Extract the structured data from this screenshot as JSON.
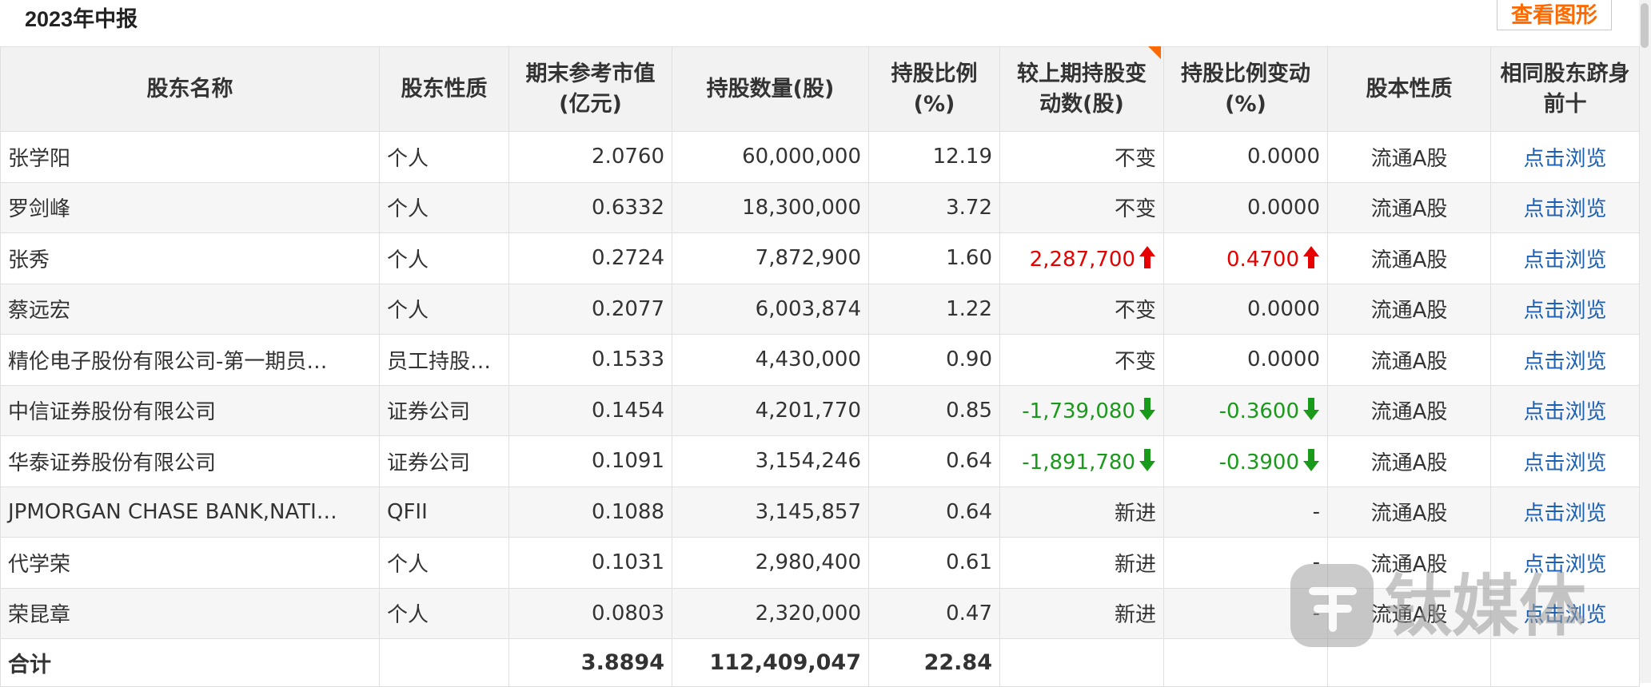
{
  "report": {
    "title": "2023年中报",
    "view_chart": "查看图形"
  },
  "columns": [
    "股东名称",
    "股东性质",
    "期末参考市值(亿元)",
    "持股数量(股)",
    "持股比例(%)",
    "较上期持股变动数(股)",
    "持股比例变动(%)",
    "股本性质",
    "相同股东跻身前十"
  ],
  "rows": [
    {
      "name": "张学阳",
      "type": "个人",
      "value": "2.0760",
      "shares": "60,000,000",
      "ratio": "12.19",
      "change": "不变",
      "change_dir": "",
      "ratio_change": "0.0000",
      "ratio_dir": "",
      "nature": "流通A股",
      "link": "点击浏览"
    },
    {
      "name": "罗剑峰",
      "type": "个人",
      "value": "0.6332",
      "shares": "18,300,000",
      "ratio": "3.72",
      "change": "不变",
      "change_dir": "",
      "ratio_change": "0.0000",
      "ratio_dir": "",
      "nature": "流通A股",
      "link": "点击浏览"
    },
    {
      "name": "张秀",
      "type": "个人",
      "value": "0.2724",
      "shares": "7,872,900",
      "ratio": "1.60",
      "change": "2,287,700",
      "change_dir": "up",
      "ratio_change": "0.4700",
      "ratio_dir": "up",
      "nature": "流通A股",
      "link": "点击浏览"
    },
    {
      "name": "蔡远宏",
      "type": "个人",
      "value": "0.2077",
      "shares": "6,003,874",
      "ratio": "1.22",
      "change": "不变",
      "change_dir": "",
      "ratio_change": "0.0000",
      "ratio_dir": "",
      "nature": "流通A股",
      "link": "点击浏览"
    },
    {
      "name": "精伦电子股份有限公司-第一期员…",
      "type": "员工持股…",
      "value": "0.1533",
      "shares": "4,430,000",
      "ratio": "0.90",
      "change": "不变",
      "change_dir": "",
      "ratio_change": "0.0000",
      "ratio_dir": "",
      "nature": "流通A股",
      "link": "点击浏览"
    },
    {
      "name": "中信证券股份有限公司",
      "type": "证券公司",
      "value": "0.1454",
      "shares": "4,201,770",
      "ratio": "0.85",
      "change": "-1,739,080",
      "change_dir": "down",
      "ratio_change": "-0.3600",
      "ratio_dir": "down",
      "nature": "流通A股",
      "link": "点击浏览"
    },
    {
      "name": "华泰证券股份有限公司",
      "type": "证券公司",
      "value": "0.1091",
      "shares": "3,154,246",
      "ratio": "0.64",
      "change": "-1,891,780",
      "change_dir": "down",
      "ratio_change": "-0.3900",
      "ratio_dir": "down",
      "nature": "流通A股",
      "link": "点击浏览"
    },
    {
      "name": "JPMORGAN CHASE BANK,NATI…",
      "type": "QFII",
      "value": "0.1088",
      "shares": "3,145,857",
      "ratio": "0.64",
      "change": "新进",
      "change_dir": "",
      "ratio_change": "-",
      "ratio_dir": "",
      "nature": "流通A股",
      "link": "点击浏览"
    },
    {
      "name": "代学荣",
      "type": "个人",
      "value": "0.1031",
      "shares": "2,980,400",
      "ratio": "0.61",
      "change": "新进",
      "change_dir": "",
      "ratio_change": "-",
      "ratio_dir": "",
      "nature": "流通A股",
      "link": "点击浏览"
    },
    {
      "name": "荣昆章",
      "type": "个人",
      "value": "0.0803",
      "shares": "2,320,000",
      "ratio": "0.47",
      "change": "新进",
      "change_dir": "",
      "ratio_change": "-",
      "ratio_dir": "",
      "nature": "流通A股",
      "link": "点击浏览"
    }
  ],
  "total": {
    "label": "合计",
    "value": "3.8894",
    "shares": "112,409,047",
    "ratio": "22.84"
  },
  "watermark": {
    "text": "钛媒体"
  },
  "colors": {
    "accent": "#ff6a00",
    "up": "#e60000",
    "down": "#1a9a1a",
    "link": "#1d5fb0"
  }
}
